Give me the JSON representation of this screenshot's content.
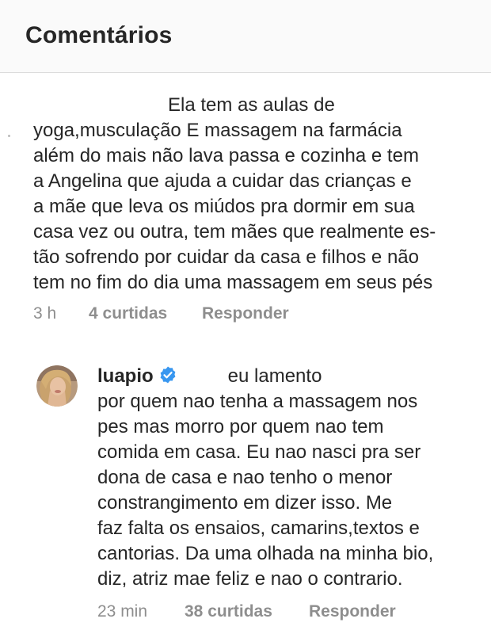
{
  "header": {
    "title": "Comentários"
  },
  "comments": [
    {
      "text": "Ela tem as aulas de\nyoga,musculação E massagem na farmácia\nalém do mais não lava passa e cozinha e tem\na Angelina que ajuda a cuidar das crianças  e\na mãe que leva os miúdos pra dormir em sua\ncasa vez ou outra, tem mães que realmente es-\ntão sofrendo por cuidar da casa e filhos e não\ntem no fim do dia uma massagem em seus pés",
      "time": "3 h",
      "likes": "4 curtidas",
      "reply": "Responder"
    },
    {
      "username": "luapio",
      "verified": true,
      "text_first": "eu lamento",
      "text": "por quem nao tenha a massagem nos\npes mas morro por quem nao tem\ncomida em casa. Eu nao nasci pra ser\ndona de casa e nao tenho o menor\nconstrangimento em dizer isso. Me\nfaz falta os ensaios, camarins,textos e\ncantorias. Da uma olhada na minha bio,\ndiz, atriz mae feliz e nao o contrario.",
      "time": "23 min",
      "likes": "38 curtidas",
      "reply": "Responder"
    }
  ],
  "colors": {
    "text": "#262626",
    "meta": "#8e8e8e",
    "verified": "#3897f0",
    "header_bg": "#fafafa"
  },
  "icons": {
    "verified": "verified-badge-icon"
  }
}
